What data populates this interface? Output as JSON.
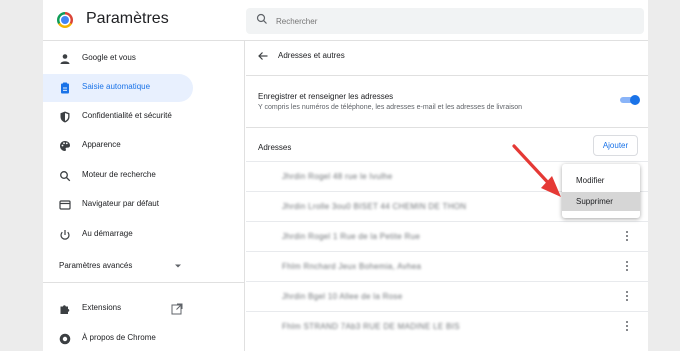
{
  "app": {
    "title": "Paramètres"
  },
  "search": {
    "placeholder": "Rechercher"
  },
  "sidebar": {
    "items": [
      {
        "label": "Google et vous",
        "icon": "person-icon"
      },
      {
        "label": "Saisie automatique",
        "icon": "clipboard-icon",
        "active": true
      },
      {
        "label": "Confidentialité et sécurité",
        "icon": "shield-icon"
      },
      {
        "label": "Apparence",
        "icon": "palette-icon"
      },
      {
        "label": "Moteur de recherche",
        "icon": "search-icon"
      },
      {
        "label": "Navigateur par défaut",
        "icon": "browser-icon"
      },
      {
        "label": "Au démarrage",
        "icon": "power-icon"
      }
    ],
    "advanced": "Paramètres avancés",
    "extensions": "Extensions",
    "about": "À propos de Chrome"
  },
  "subpage": {
    "title": "Adresses et autres",
    "save_label": "Enregistrer et renseigner les adresses",
    "save_sub": "Y compris les numéros de téléphone, les adresses e-mail et les adresses de livraison",
    "toggle_on": true,
    "section_label": "Adresses",
    "add_label": "Ajouter"
  },
  "addresses": [
    "Jhrdin Rogel 48 rue le Ivulhe",
    "Jhrdin Lrolle 3ou0 BISET 44 CHEMIN DE THON",
    "Jhrdin Rogel 1 Rue de la Petite Rue",
    "Fhlm Rnchard Jeux Bohemia, Avhea",
    "Jhrdin Bgel 10 Allee de la Rose",
    "Fhlm STRAND 7Ab3 RUE DE MADINE LE BIS"
  ],
  "context_menu": {
    "edit": "Modifier",
    "delete": "Supprimer"
  },
  "colors": {
    "accent": "#1a73e8",
    "arrow": "#e53935"
  }
}
